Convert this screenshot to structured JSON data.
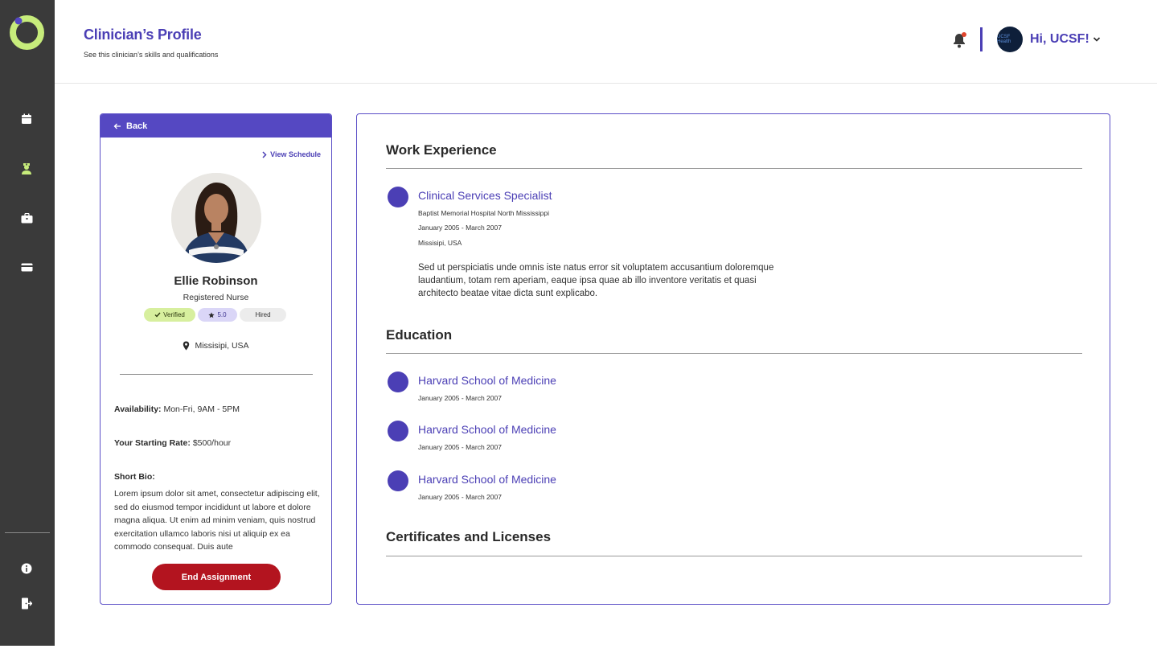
{
  "header": {
    "title": "Clinician’s Profile",
    "subtitle": "See this clinician’s skills and qualifications",
    "greeting": "Hi, UCSF!",
    "avatar_text": "UCSF Health"
  },
  "sidebar": {
    "items": [
      {
        "icon": "calendar-icon"
      },
      {
        "icon": "nurse-icon"
      },
      {
        "icon": "briefcase-icon"
      },
      {
        "icon": "credit-card-icon"
      },
      {
        "icon": "info-icon"
      },
      {
        "icon": "logout-icon"
      }
    ]
  },
  "profile": {
    "back_label": "Back",
    "view_schedule_label": "View Schedule",
    "name": "Ellie Robinson",
    "role": "Registered Nurse",
    "badges": {
      "verified": "Verified",
      "rating": "5.0",
      "hired": "Hired"
    },
    "location": "Missisipi, USA",
    "availability_label": "Availability:",
    "availability_value": "Mon-Fri, 9AM - 5PM",
    "rate_label": "Your Starting Rate:",
    "rate_value": "$500/hour",
    "bio_label": "Short Bio:",
    "bio_text": "Lorem ipsum dolor sit amet, consectetur adipiscing elit, sed do eiusmod tempor incididunt ut labore et dolore magna aliqua. Ut enim ad minim veniam, quis nostrud exercitation ullamco laboris nisi ut aliquip ex ea commodo consequat. Duis aute",
    "end_button_label": "End Assignment"
  },
  "work_experience": {
    "title": "Work Experience",
    "entries": [
      {
        "title": "Clinical Services Specialist",
        "organization": "Baptist Memorial Hospital North Mississippi",
        "dates": "January 2005 - March 2007",
        "location": "Missisipi, USA",
        "description": "Sed ut perspiciatis unde omnis iste natus error sit voluptatem accusantium doloremque laudantium, totam rem aperiam, eaque ipsa quae ab illo inventore veritatis et quasi architecto beatae vitae dicta sunt explicabo."
      }
    ]
  },
  "education": {
    "title": "Education",
    "entries": [
      {
        "title": "Harvard School of Medicine",
        "dates": "January 2005 - March 2007"
      },
      {
        "title": "Harvard School of Medicine",
        "dates": "January 2005 - March 2007"
      },
      {
        "title": "Harvard School of Medicine",
        "dates": "January 2005 - March 2007"
      }
    ]
  },
  "certificates": {
    "title": "Certificates and Licenses"
  },
  "colors": {
    "brand": "#4b3fb5",
    "sidebar": "#3a3a3a",
    "logo_green": "#c7ec7b",
    "danger": "#b3141f",
    "verified_bg": "#d7ef9e",
    "rating_bg": "#dad6f7"
  }
}
